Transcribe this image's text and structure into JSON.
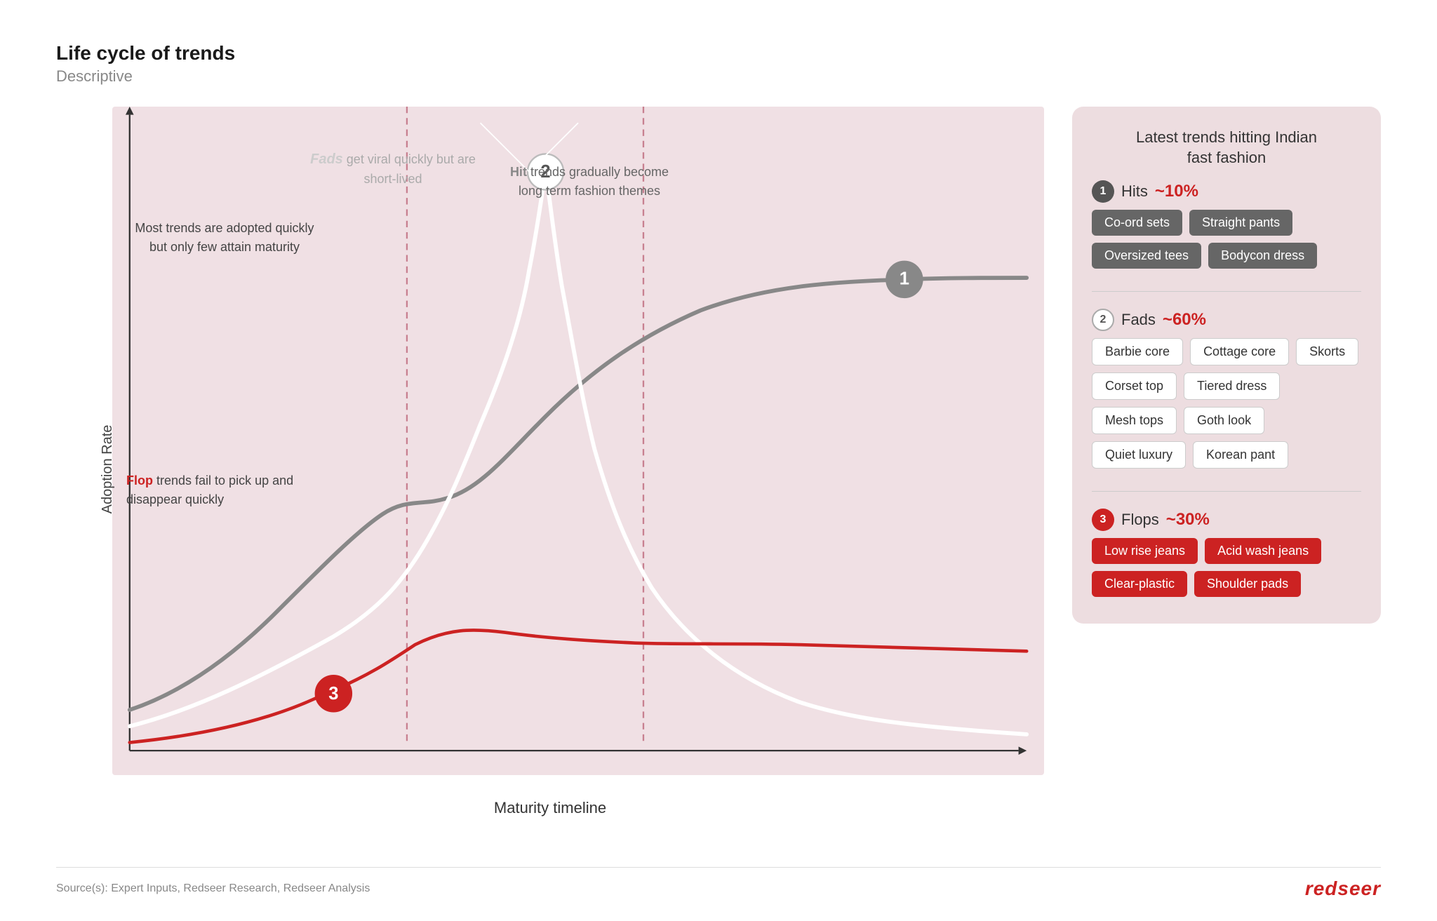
{
  "header": {
    "title": "Life cycle of trends",
    "subtitle": "Descriptive"
  },
  "chart": {
    "y_label": "Adoption Rate",
    "x_label": "Maturity timeline",
    "annotations": {
      "most_trends": "Most trends are adopted\nquickly but only few attain\nmaturity",
      "fads": "Fads get viral quickly but\nare short-lived",
      "hit": "Hit trends gradually\nbecome long term\nfashion themes",
      "flop": "Flop trends fail to pick up\nand disappear quickly"
    }
  },
  "right_panel": {
    "title": "Latest trends hitting Indian\nfast fashion",
    "sections": [
      {
        "number": "1",
        "label": "Hits",
        "pct": "~10%",
        "tags": [
          "Co-ord sets",
          "Straight pants",
          "Oversized tees",
          "Bodycon dress"
        ],
        "tag_style": "dark"
      },
      {
        "number": "2",
        "label": "Fads",
        "pct": "~60%",
        "tags": [
          "Barbie core",
          "Cottage core",
          "Skorts",
          "Corset top",
          "Tiered dress",
          "Mesh tops",
          "Goth look",
          "Quiet luxury",
          "Korean pant"
        ],
        "tag_style": "outline"
      },
      {
        "number": "3",
        "label": "Flops",
        "pct": "~30%",
        "tags": [
          "Low rise jeans",
          "Acid wash jeans",
          "Clear-plastic",
          "Shoulder pads"
        ],
        "tag_style": "red"
      }
    ]
  },
  "footer": {
    "source": "Source(s): Expert Inputs, Redseer Research, Redseer Analysis",
    "brand": "redseer"
  }
}
